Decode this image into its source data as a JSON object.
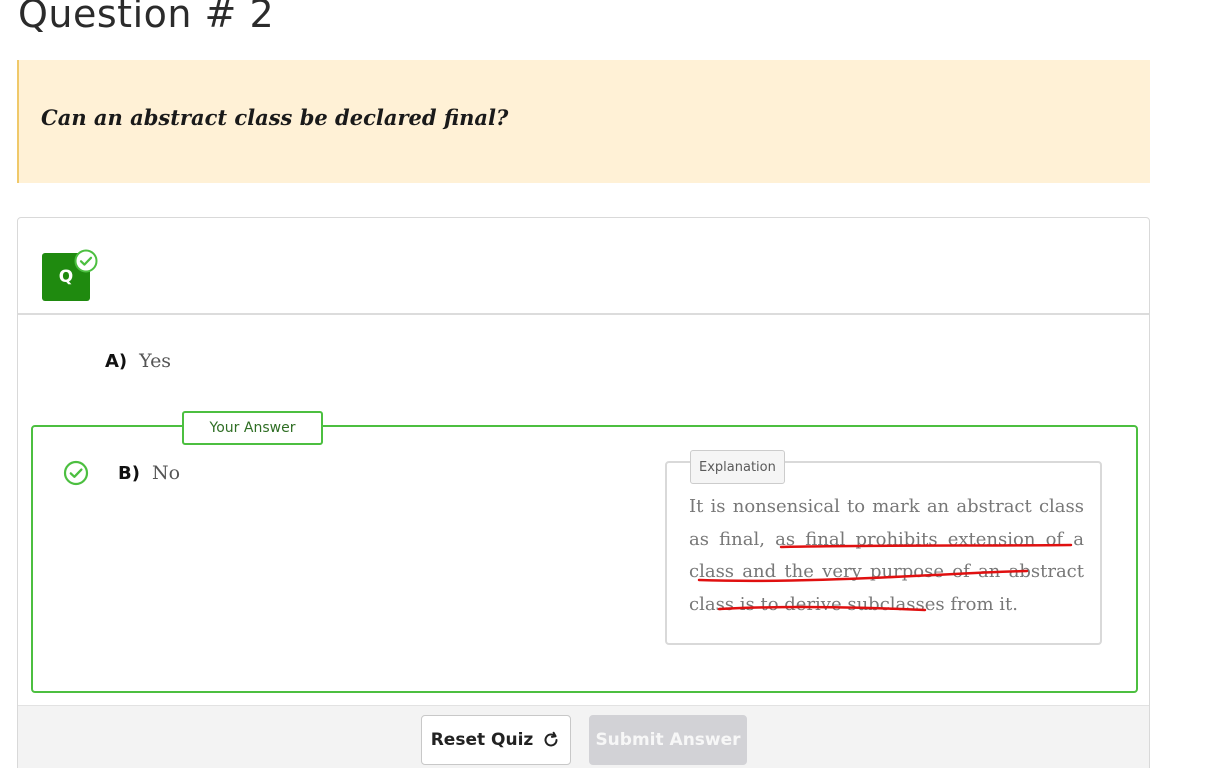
{
  "question": {
    "heading": "Question # 2",
    "prompt": "Can an abstract class be declared final?"
  },
  "card": {
    "badge_label": "Q",
    "options": [
      {
        "letter": "A)",
        "text": "Yes"
      },
      {
        "letter": "B)",
        "text": "No"
      }
    ],
    "your_answer_label": "Your Answer",
    "explanation": {
      "label": "Explanation",
      "text": "It is nonsensical to mark an abstract class as final, as final prohibits extension of a class and the very purpose of an abstract class is to derive subclasses from it."
    }
  },
  "footer": {
    "reset_label": "Reset Quiz",
    "submit_label": "Submit Answer"
  },
  "colors": {
    "correct_green": "#4cbf40",
    "badge_green": "#1f8a0f",
    "prompt_bg": "#fff1d6",
    "annotation_red": "#e01010"
  },
  "icons": {
    "badge_status": "check-circle-icon",
    "answer_status": "check-circle-icon",
    "reset": "refresh-icon"
  }
}
